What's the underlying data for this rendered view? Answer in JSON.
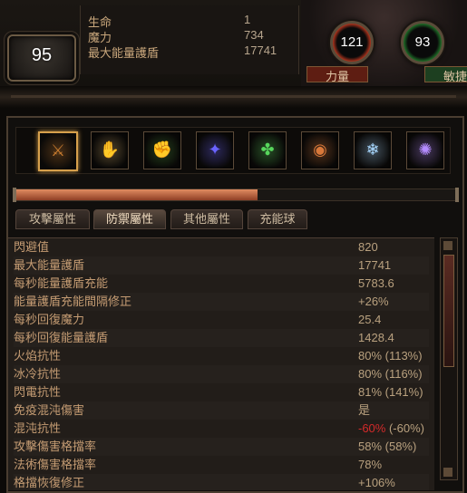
{
  "character": {
    "level": "95"
  },
  "top_stats": [
    {
      "label": "生命",
      "value": "1"
    },
    {
      "label": "魔力",
      "value": "734"
    },
    {
      "label": "最大能量護盾",
      "value": "17741"
    }
  ],
  "attributes": {
    "strength": {
      "value": "121",
      "label": "力量"
    },
    "dexterity": {
      "value": "93",
      "label": "敏捷"
    }
  },
  "skills": [
    {
      "icon": "sword-skill-icon",
      "glyph": "⚔",
      "color": "#c97c2f"
    },
    {
      "icon": "claw-skill-icon",
      "glyph": "✋",
      "color": "#d8b26b"
    },
    {
      "icon": "fist-skill-icon",
      "glyph": "✊",
      "color": "#4b9c3c"
    },
    {
      "icon": "arcane-skill-icon",
      "glyph": "✦",
      "color": "#6a63ff"
    },
    {
      "icon": "leaf-skill-icon",
      "glyph": "✤",
      "color": "#57d65c"
    },
    {
      "icon": "orb-skill-icon",
      "glyph": "◉",
      "color": "#d8783a"
    },
    {
      "icon": "ice-skill-icon",
      "glyph": "❄",
      "color": "#a9d8ff"
    },
    {
      "icon": "swirl-skill-icon",
      "glyph": "✺",
      "color": "#b58cff"
    }
  ],
  "experience": {
    "progress": 0.55
  },
  "tabs": [
    "攻擊屬性",
    "防禦屬性",
    "其他屬性",
    "充能球"
  ],
  "active_tab": "防禦屬性",
  "defense_stats": [
    {
      "label": "閃避值",
      "value": "820"
    },
    {
      "label": "最大能量護盾",
      "value": "17741"
    },
    {
      "label": "每秒能量護盾充能",
      "value": "5783.6"
    },
    {
      "label": "能量護盾充能間隔修正",
      "value": "+26%"
    },
    {
      "label": "每秒回復魔力",
      "value": "25.4"
    },
    {
      "label": "每秒回復能量護盾",
      "value": "1428.4"
    },
    {
      "label": "火焰抗性",
      "value": "80% (113%)"
    },
    {
      "label": "冰冷抗性",
      "value": "80% (116%)"
    },
    {
      "label": "閃電抗性",
      "value": "81% (141%)"
    },
    {
      "label": "免疫混沌傷害",
      "value": "是"
    },
    {
      "label": "混沌抗性",
      "value_neg": "-60%",
      "value_rest": " (-60%)"
    },
    {
      "label": "攻擊傷害格擋率",
      "value": "58% (58%)"
    },
    {
      "label": "法術傷害格擋率",
      "value": "78%"
    },
    {
      "label": "格擋恢復修正",
      "value": "+106%"
    }
  ]
}
